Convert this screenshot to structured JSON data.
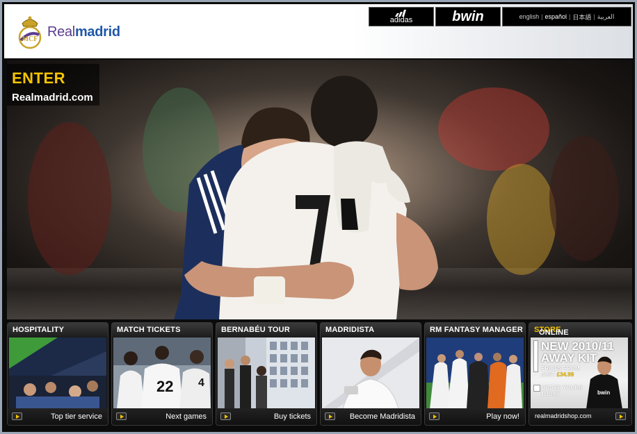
{
  "header": {
    "brand_light": "Real",
    "brand_bold": "madrid",
    "sponsors": {
      "adidas": "adidas",
      "bwin": "bwin"
    },
    "languages": [
      "english",
      "español",
      "日本語",
      "العربية"
    ]
  },
  "hero": {
    "enter": "ENTER",
    "site": "Realmadrid.com",
    "shirt_number": "7"
  },
  "tiles": [
    {
      "title": "HOSPITALITY",
      "footer": "Top tier service"
    },
    {
      "title": "MATCH TICKETS",
      "footer": "Next games",
      "shirt_numbers": [
        "22",
        "4"
      ]
    },
    {
      "title": "BERNABÉU TOUR",
      "footer": "Buy tickets"
    },
    {
      "title": "MADRIDISTA",
      "footer": "Become Madridista"
    },
    {
      "title": "RM FANTASY MANAGER",
      "footer": "Play now!"
    }
  ],
  "store": {
    "title_white": "ONLINE ",
    "title_yellow": "STORE",
    "kit_line1": "NEW 2010/11",
    "kit_line2": "AWAY KIT",
    "prices_from": "PRICES FROM",
    "just": "JUST ",
    "price": "£34.99",
    "order_line1": "ORDER YOURS",
    "order_line2": "TODAY",
    "shirt_sponsor": "bwin",
    "footer": "realmadridshop.com"
  },
  "colors": {
    "accent_yellow": "#f5c400",
    "brand_blue": "#1f57a8",
    "brand_purple": "#5b3d8f"
  }
}
